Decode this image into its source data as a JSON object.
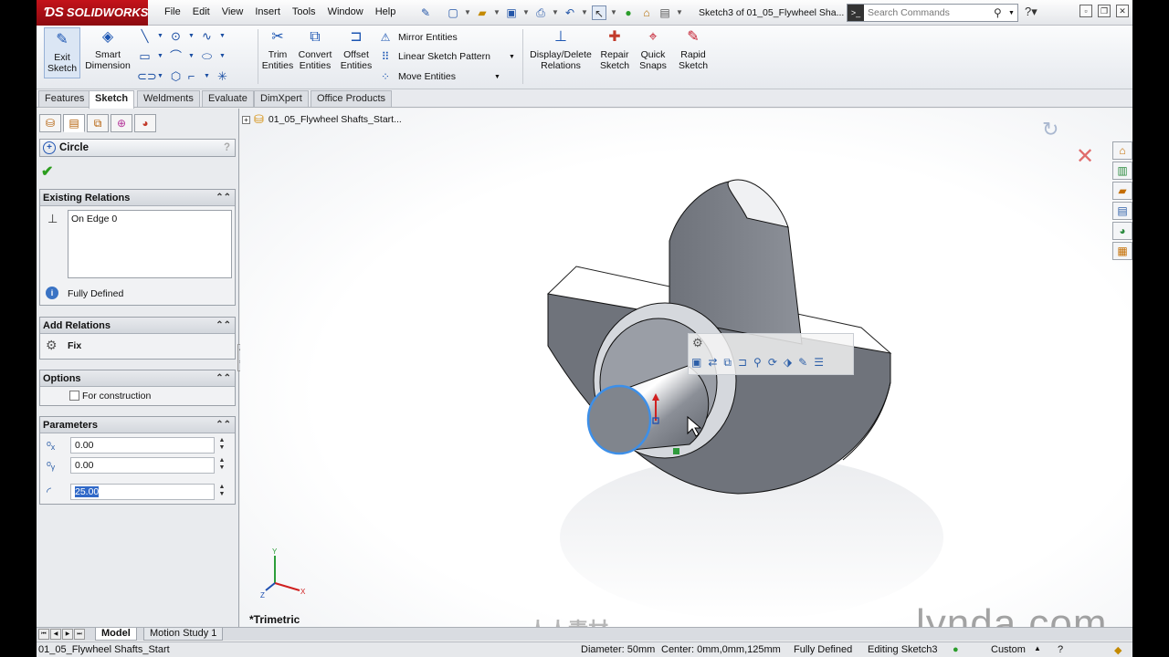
{
  "app": {
    "logo": "SOLIDWORKS",
    "document_title": "Sketch3 of 01_05_Flywheel Sha..."
  },
  "menu": [
    "File",
    "Edit",
    "View",
    "Insert",
    "Tools",
    "Window",
    "Help"
  ],
  "search": {
    "placeholder": "Search Commands"
  },
  "commands": {
    "exit_sketch": "Exit Sketch",
    "smart_dimension": "Smart Dimension",
    "trim_entities": "Trim Entities",
    "convert_entities": "Convert Entities",
    "offset_entities": "Offset Entities",
    "mirror_entities": "Mirror Entities",
    "linear_sketch_pattern": "Linear Sketch Pattern",
    "move_entities": "Move Entities",
    "display_delete_relations": "Display/Delete Relations",
    "repair_sketch": "Repair Sketch",
    "quick_snaps": "Quick Snaps",
    "rapid_sketch": "Rapid Sketch"
  },
  "tabs": [
    "Features",
    "Sketch",
    "Weldments",
    "Evaluate",
    "DimXpert",
    "Office Products"
  ],
  "active_tab": "Sketch",
  "property_manager": {
    "title": "Circle",
    "existing_relations": {
      "header": "Existing Relations",
      "items": [
        "On Edge 0"
      ],
      "status": "Fully Defined"
    },
    "add_relations": {
      "header": "Add Relations",
      "items": [
        "Fix"
      ]
    },
    "options": {
      "header": "Options",
      "for_construction": "For construction"
    },
    "parameters": {
      "header": "Parameters",
      "cx": "0.00",
      "cy": "0.00",
      "radius": "25.00"
    }
  },
  "graphics": {
    "tree_root": "01_05_Flywheel Shafts_Start...",
    "view_orientation": "*Trimetric",
    "triad": {
      "x": "X",
      "y": "Y",
      "z": "Z"
    },
    "watermark": "lynda.com",
    "watermark_cn": "人人素材"
  },
  "bottom_tabs": [
    "Model",
    "Motion Study 1"
  ],
  "status_bar": {
    "document": "01_05_Flywheel Shafts_Start",
    "diameter": "Diameter: 50mm",
    "center": "Center: 0mm,0mm,125mm",
    "state": "Fully Defined",
    "editing": "Editing Sketch3",
    "units": "Custom"
  },
  "colors": {
    "accent": "#2457b3",
    "logo_red": "#c4121a",
    "selection_blue": "#3069c8",
    "ok_green": "#2c9e1e"
  }
}
